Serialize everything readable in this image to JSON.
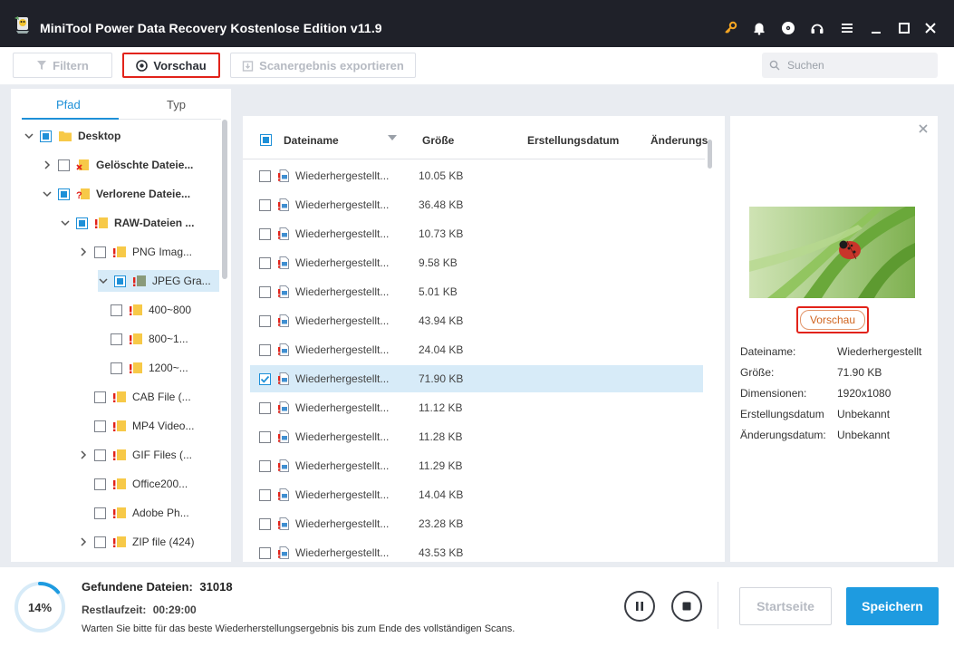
{
  "window": {
    "title": "MiniTool Power Data Recovery Kostenlose Edition v11.9",
    "icons": [
      "key-icon",
      "bell-icon",
      "disc-icon",
      "headphones-icon",
      "menu-icon",
      "minimize-icon",
      "maximize-icon",
      "close-icon"
    ]
  },
  "toolbar": {
    "filter_label": "Filtern",
    "preview_label": "Vorschau",
    "export_label": "Scanergebnis exportieren",
    "search_placeholder": "Suchen"
  },
  "tree": {
    "tabs": [
      "Pfad",
      "Typ"
    ],
    "items": [
      {
        "label": "Desktop",
        "level": 0,
        "expand": "open",
        "check": "partial",
        "icon": "folder"
      },
      {
        "label": "Gelöschte Dateie...",
        "level": 1,
        "expand": "closed",
        "check": "none",
        "icon": "folder-deleted"
      },
      {
        "label": "Verlorene Dateie...",
        "level": 1,
        "expand": "open",
        "check": "partial",
        "icon": "folder-lost"
      },
      {
        "label": "RAW-Dateien ...",
        "level": 2,
        "expand": "open",
        "check": "partial",
        "icon": "folder-raw"
      },
      {
        "label": "PNG Imag...",
        "level": 3,
        "expand": "closed",
        "check": "none",
        "icon": "folder-raw"
      },
      {
        "label": "JPEG Gra...",
        "level": 3,
        "expand": "open",
        "check": "partial",
        "icon": "folder-raw-grey"
      },
      {
        "label": "400~800",
        "level": 4,
        "expand": "none",
        "check": "none",
        "icon": "folder-raw"
      },
      {
        "label": "800~1...",
        "level": 4,
        "expand": "none",
        "check": "none",
        "icon": "folder-raw"
      },
      {
        "label": "1200~...",
        "level": 4,
        "expand": "none",
        "check": "none",
        "icon": "folder-raw"
      },
      {
        "label": "CAB File (...",
        "level": 3,
        "expand": "none",
        "check": "none",
        "icon": "folder-raw"
      },
      {
        "label": "MP4 Video...",
        "level": 3,
        "expand": "none",
        "check": "none",
        "icon": "folder-raw"
      },
      {
        "label": "GIF Files (...",
        "level": 3,
        "expand": "closed",
        "check": "none",
        "icon": "folder-raw"
      },
      {
        "label": "Office200...",
        "level": 3,
        "expand": "none",
        "check": "none",
        "icon": "folder-raw"
      },
      {
        "label": "Adobe Ph...",
        "level": 3,
        "expand": "none",
        "check": "none",
        "icon": "folder-raw"
      },
      {
        "label": "ZIP file (424)",
        "level": 3,
        "expand": "closed",
        "check": "none",
        "icon": "folder-raw"
      }
    ]
  },
  "file_list": {
    "columns": [
      "Dateiname",
      "Größe",
      "Erstellungsdatum",
      "Änderungs"
    ],
    "rows": [
      {
        "name": "Wiederhergestellt...",
        "size": "10.05 KB",
        "checked": false
      },
      {
        "name": "Wiederhergestellt...",
        "size": "36.48 KB",
        "checked": false
      },
      {
        "name": "Wiederhergestellt...",
        "size": "10.73 KB",
        "checked": false
      },
      {
        "name": "Wiederhergestellt...",
        "size": "9.58 KB",
        "checked": false
      },
      {
        "name": "Wiederhergestellt...",
        "size": "5.01 KB",
        "checked": false
      },
      {
        "name": "Wiederhergestellt...",
        "size": "43.94 KB",
        "checked": false
      },
      {
        "name": "Wiederhergestellt...",
        "size": "24.04 KB",
        "checked": false
      },
      {
        "name": "Wiederhergestellt...",
        "size": "71.90 KB",
        "checked": true
      },
      {
        "name": "Wiederhergestellt...",
        "size": "11.12 KB",
        "checked": false
      },
      {
        "name": "Wiederhergestellt...",
        "size": "11.28 KB",
        "checked": false
      },
      {
        "name": "Wiederhergestellt...",
        "size": "11.29 KB",
        "checked": false
      },
      {
        "name": "Wiederhergestellt...",
        "size": "14.04 KB",
        "checked": false
      },
      {
        "name": "Wiederhergestellt...",
        "size": "23.28 KB",
        "checked": false
      },
      {
        "name": "Wiederhergestellt...",
        "size": "43.53 KB",
        "checked": false
      }
    ]
  },
  "preview": {
    "button_label": "Vorschau",
    "info": [
      {
        "key": "Dateiname:",
        "value": "Wiederhergestellt"
      },
      {
        "key": "Größe:",
        "value": "71.90 KB"
      },
      {
        "key": "Dimensionen:",
        "value": "1920x1080"
      },
      {
        "key": "Erstellungsdatum",
        "value": "Unbekannt"
      },
      {
        "key": "Änderungsdatum:",
        "value": "Unbekannt"
      }
    ]
  },
  "status": {
    "progress": 14,
    "progress_text": "14%",
    "found_label": "Gefundene Dateien:",
    "found_value": "31018",
    "remaining_label": "Restlaufzeit:",
    "remaining_value": "00:29:00",
    "hint": "Warten Sie bitte für das beste Wiederherstellungsergebnis bis zum Ende des vollständigen Scans.",
    "home_label": "Startseite",
    "save_label": "Speichern"
  },
  "colors": {
    "accent": "#1e9be0",
    "highlight_red": "#e2231a",
    "titlebar": "#1f2129",
    "selection": "#d7ebf8"
  }
}
